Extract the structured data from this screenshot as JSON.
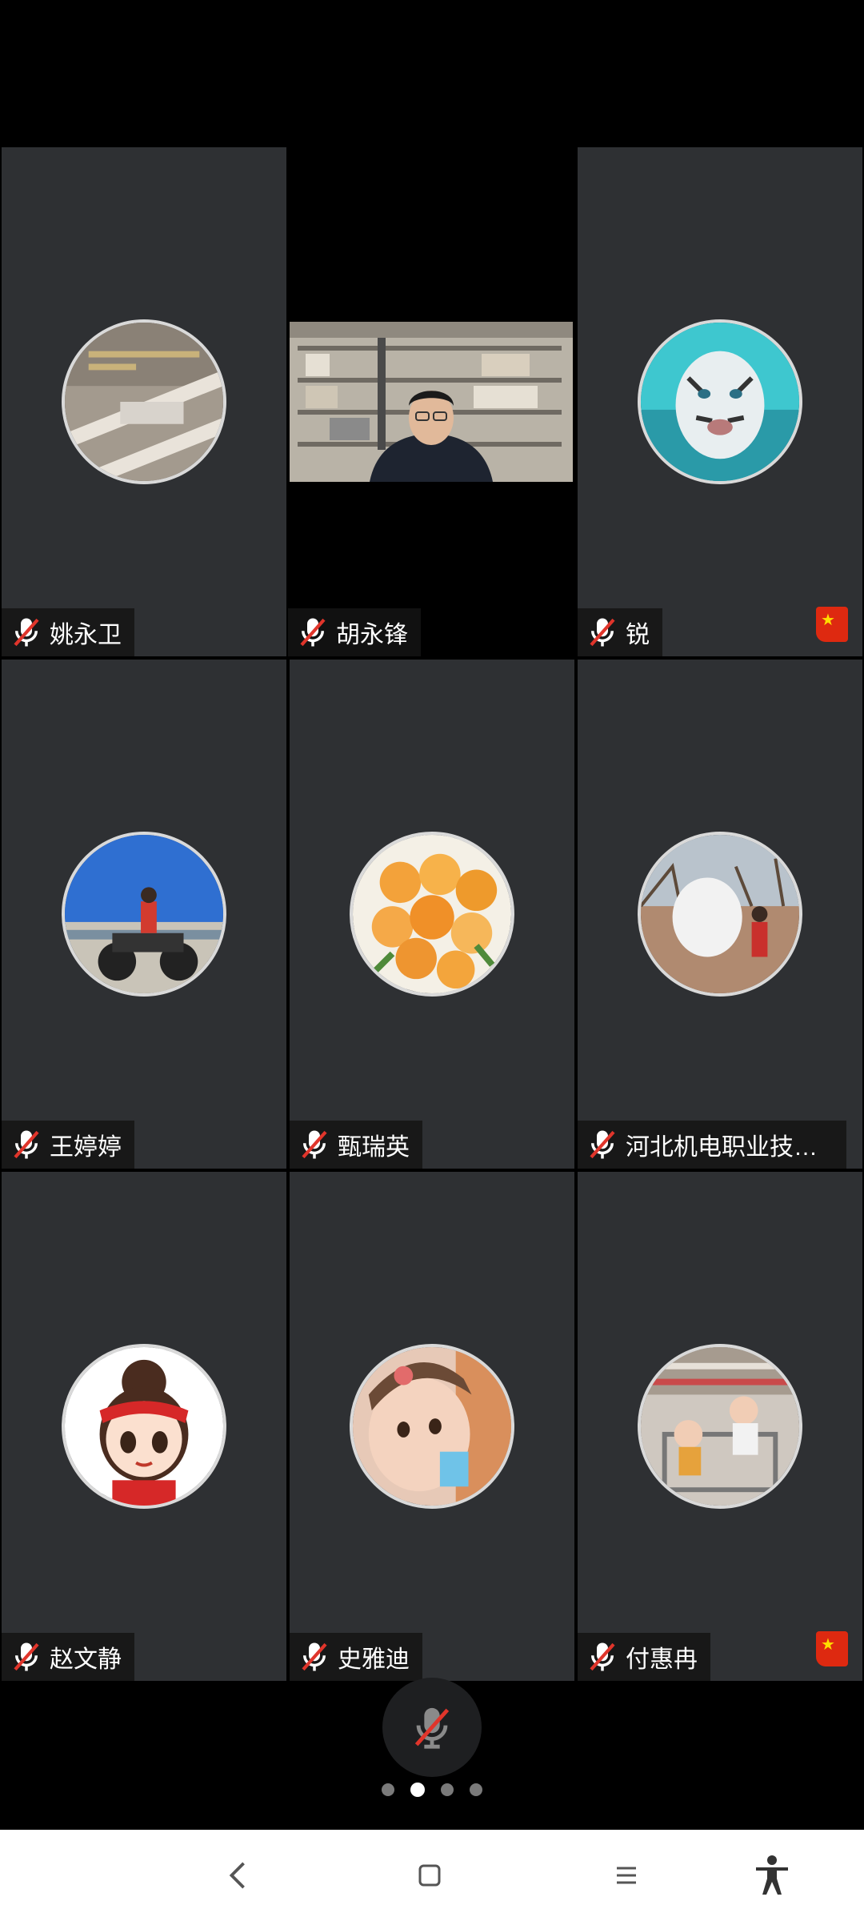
{
  "participants": [
    {
      "name": "姚永卫",
      "avatar": "wall-quote-photo",
      "flag": false
    },
    {
      "name": "胡永锋",
      "avatar": "live-video-man-in-study",
      "flag": false
    },
    {
      "name": "锐",
      "avatar": "white-tiger-underwater",
      "flag": true
    },
    {
      "name": "王婷婷",
      "avatar": "person-on-atv",
      "flag": false
    },
    {
      "name": "甄瑞英",
      "avatar": "orange-roses-bouquet",
      "flag": false
    },
    {
      "name": "河北机电职业技术...",
      "avatar": "child-in-park-with-cloud",
      "flag": false
    },
    {
      "name": "赵文静",
      "avatar": "cartoon-girl-red-bandana",
      "flag": false
    },
    {
      "name": "史雅迪",
      "avatar": "toddler-drinking",
      "flag": false
    },
    {
      "name": "付惠冉",
      "avatar": "kids-in-shopping-cart",
      "flag": true
    }
  ],
  "controls": {
    "mic_state": "muted",
    "mic_icon": "mic-off-icon"
  },
  "pager": {
    "page_count": 4,
    "current_page": 2
  },
  "nav": {
    "back_icon": "back-chevron-icon",
    "home_icon": "home-square-icon",
    "menu_icon": "menu-lines-icon",
    "accessibility_icon": "accessibility-icon"
  },
  "colors": {
    "tile_bg": "#2e3033",
    "muted_red": "#e0352b",
    "flag_red": "#de2910"
  }
}
